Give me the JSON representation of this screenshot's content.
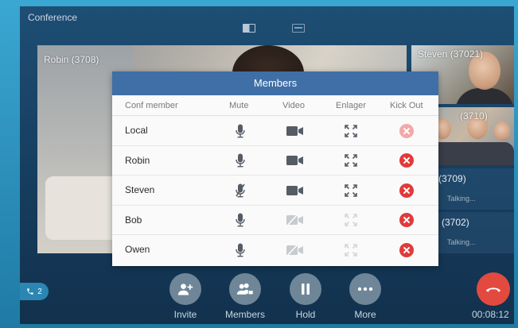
{
  "app": {
    "title": "Conference"
  },
  "layout_buttons": [
    {
      "name": "layout-mode-1-icon"
    },
    {
      "name": "layout-mode-2-icon"
    }
  ],
  "main_video": {
    "label": "Robin (3708)"
  },
  "side_tiles": [
    {
      "label": "Steven (37021)"
    },
    {
      "label": "(3710)"
    }
  ],
  "side_cards": [
    {
      "name": "(3709)",
      "status": "Talking..."
    },
    {
      "name": "n (3702)",
      "status": "Talking..."
    }
  ],
  "members_dialog": {
    "title": "Members",
    "columns": [
      "Conf member",
      "Mute",
      "Video",
      "Enlager",
      "Kick Out"
    ],
    "rows": [
      {
        "name": "Local",
        "mute": "on",
        "video": "on",
        "enlarge": "on",
        "kick": "disabled"
      },
      {
        "name": "Robin",
        "mute": "on",
        "video": "on",
        "enlarge": "on",
        "kick": "enabled"
      },
      {
        "name": "Steven",
        "mute": "muted",
        "video": "on",
        "enlarge": "on",
        "kick": "enabled"
      },
      {
        "name": "Bob",
        "mute": "on",
        "video": "off",
        "enlarge": "disabled",
        "kick": "enabled"
      },
      {
        "name": "Owen",
        "mute": "on",
        "video": "off",
        "enlarge": "disabled",
        "kick": "enabled"
      }
    ]
  },
  "bottom_bar": {
    "invite": "Invite",
    "members": "Members",
    "hold": "Hold",
    "more": "More",
    "timer": "00:08:12",
    "call_count": "2"
  },
  "colors": {
    "dialog_header": "#3f6fa6",
    "kick_active": "#e03a3a",
    "kick_disabled": "#f3a8a8",
    "end_call": "#e34a3f",
    "icon_grey": "#555c66"
  }
}
